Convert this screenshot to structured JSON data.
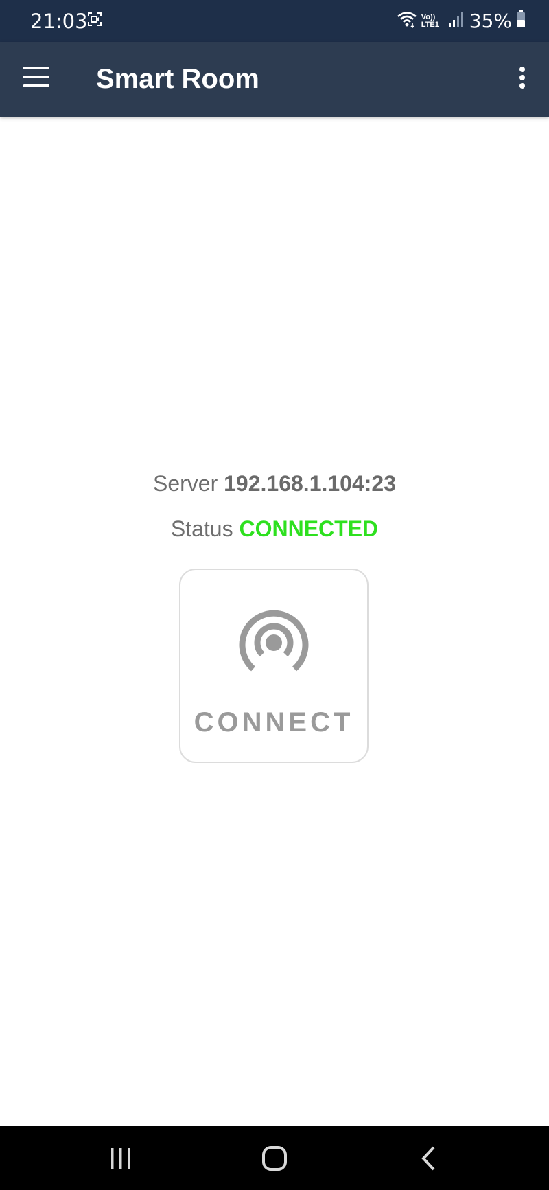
{
  "status_bar": {
    "time": "21:03",
    "network_label": "Vo)) LTE1",
    "battery_percent": "35%"
  },
  "app_bar": {
    "title": "Smart Room"
  },
  "connection": {
    "server_label": "Server",
    "server_value": "192.168.1.104:23",
    "status_label": "Status",
    "status_value": "CONNECTED",
    "status_color": "#2ee01f"
  },
  "connect_button": {
    "label": "CONNECT",
    "icon": "broadcast-icon"
  },
  "icons": {
    "menu": "menu-icon",
    "overflow": "more-vert-icon",
    "screen_record": "screen-record-icon",
    "wifi": "wifi-icon",
    "signal": "signal-icon",
    "battery": "battery-icon",
    "nav_recents": "recents-icon",
    "nav_home": "home-icon",
    "nav_back": "back-icon"
  },
  "colors": {
    "status_bar_bg": "#1e2f49",
    "app_bar_bg": "#2d3c51",
    "text_gray": "#6e6e6e",
    "button_gray": "#9a9a9a"
  }
}
